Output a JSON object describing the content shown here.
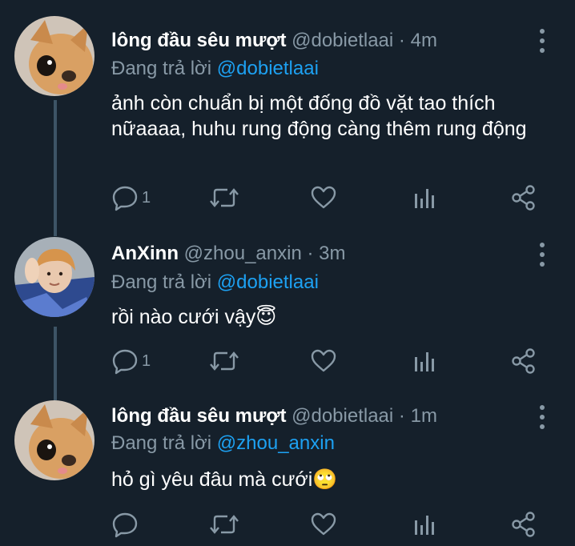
{
  "tweets": [
    {
      "name": "lông đầu sêu mượt",
      "handle": "@dobietlaai",
      "separator": "·",
      "time": "4m",
      "replying_prefix": "Đang trả lời",
      "replying_to": "@dobietlaai",
      "text": "ảnh còn chuẩn bị một đống đồ vặt tao thích nữaaaa, huhu rung động càng thêm rung động",
      "reply_count": "1",
      "avatar": "chihuahua-avatar"
    },
    {
      "name": "AnXinn",
      "handle": "@zhou_anxin",
      "separator": "·",
      "time": "3m",
      "replying_prefix": "Đang trả lời",
      "replying_to": "@dobietlaai",
      "text": "rồi nào cưới vậy😇",
      "reply_count": "1",
      "avatar": "person-avatar"
    },
    {
      "name": "lông đầu sêu mượt",
      "handle": "@dobietlaai",
      "separator": "·",
      "time": "1m",
      "replying_prefix": "Đang trả lời",
      "replying_to": "@zhou_anxin",
      "text": "hỏ gì yêu đâu mà cưới🙄",
      "reply_count": "",
      "avatar": "chihuahua-avatar"
    }
  ],
  "colors": {
    "background": "#15202b",
    "secondary_text": "#8899a6",
    "accent": "#1da1f2",
    "thread_line": "#3d5466"
  },
  "icons": [
    "reply-icon",
    "retweet-icon",
    "like-icon",
    "analytics-icon",
    "share-icon",
    "more-icon"
  ]
}
